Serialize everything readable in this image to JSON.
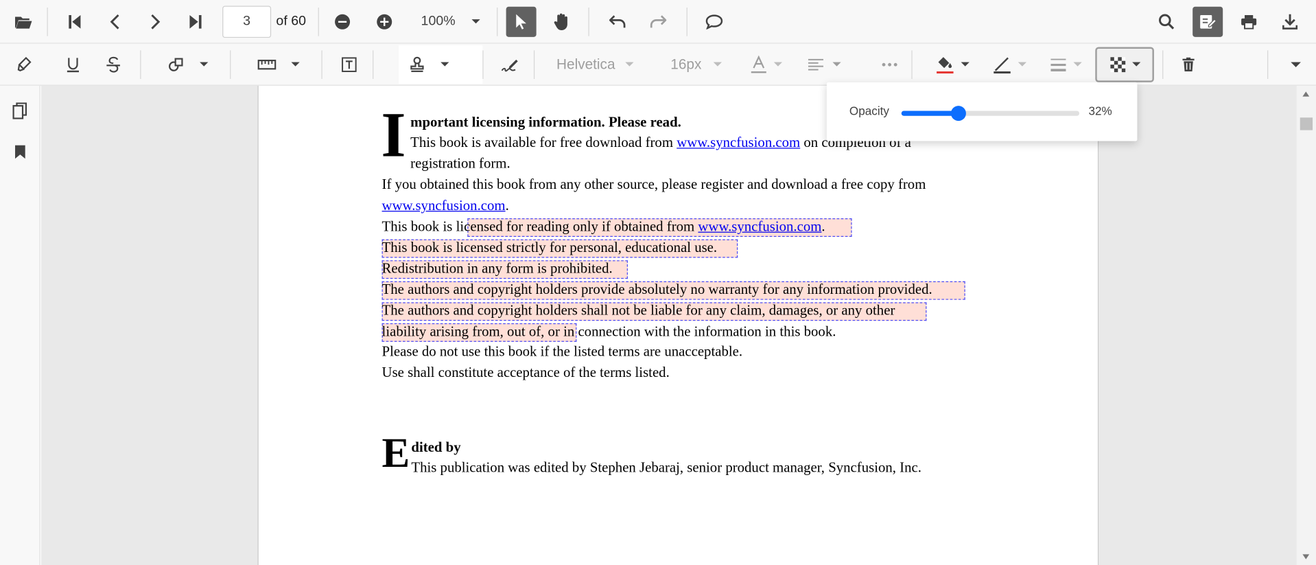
{
  "toolbar": {
    "page_number": "3",
    "of_label": "of 60",
    "zoom": "100%"
  },
  "annotation_toolbar": {
    "font_name": "Helvetica",
    "font_size": "16px",
    "text_color_accent": "#e53935"
  },
  "opacity_popup": {
    "label": "Opacity",
    "value_text": "32%",
    "value": 0.32
  },
  "document": {
    "dropcap_1": "I",
    "heading_1": "mportant licensing information. Please read.",
    "para1_a": "This book is available for free download from ",
    "para1_link": "www.syncfusion.com",
    "para1_b": " on completion of a",
    "para1_c": "registration form.",
    "para2_a": "If you obtained this book from any other source, please register and download a free copy from",
    "para2_link": "www.syncfusion.com",
    "para2_b": ".",
    "para3_a": "This book is licensed for reading only if obtained from ",
    "para3_link": "www.syncfusion.com",
    "para3_b": ".",
    "para4": "This book is licensed strictly for personal, educational use.",
    "para5": "Redistribution in any form is prohibited.",
    "para6": "The authors and copyright holders provide absolutely no warranty for any information provided.",
    "para7": "The authors and copyright holders shall not be liable for any claim, damages, or any other",
    "para8": "liability arising from, out of, or in connection with the information in this book.",
    "para9": "Please do not use this book if the listed terms are unacceptable.",
    "para10": "Use shall constitute acceptance of the terms listed.",
    "dropcap_2": "E",
    "heading_2": "dited by",
    "para11": "This publication was edited by Stephen Jebaraj, senior product manager, Syncfusion, Inc."
  }
}
